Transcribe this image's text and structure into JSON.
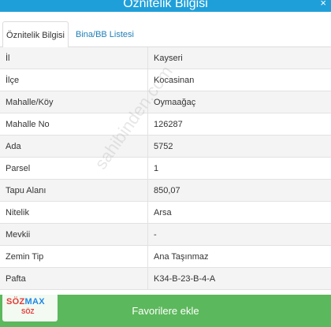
{
  "header": {
    "title": "Öznitelik Bilgisi",
    "close_glyph": "×"
  },
  "tabs": [
    {
      "label": "Öznitelik Bilgisi",
      "active": true
    },
    {
      "label": "Bina/BB Listesi",
      "active": false
    }
  ],
  "rows": [
    {
      "label": "İl",
      "value": "Kayseri"
    },
    {
      "label": "İlçe",
      "value": "Kocasinan"
    },
    {
      "label": "Mahalle/Köy",
      "value": "Oymaağaç"
    },
    {
      "label": "Mahalle No",
      "value": "126287"
    },
    {
      "label": "Ada",
      "value": "5752"
    },
    {
      "label": "Parsel",
      "value": "1"
    },
    {
      "label": "Tapu Alanı",
      "value": "850,07"
    },
    {
      "label": "Nitelik",
      "value": "Arsa"
    },
    {
      "label": "Mevkii",
      "value": "-"
    },
    {
      "label": "Zemin Tip",
      "value": "Ana Taşınmaz"
    },
    {
      "label": "Pafta",
      "value": "K34-B-23-B-4-A"
    }
  ],
  "watermark": "sahibinden.com",
  "footer": {
    "button_label": "Favorilere ekle"
  },
  "logo": {
    "main": "SÖZMAX",
    "sub": "SÖZ"
  },
  "colors": {
    "header": "#1f9fd9",
    "button": "#5cb85c",
    "link": "#1f7fb8"
  }
}
